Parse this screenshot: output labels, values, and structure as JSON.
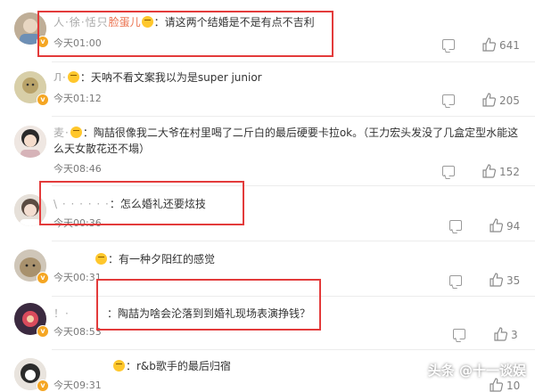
{
  "comments": [
    {
      "user": "人·徐·恬只",
      "user2": "脸蛋儿",
      "text": "：请这两个结婚是不是有点不吉利",
      "time": "今天01:00",
      "likes": "641"
    },
    {
      "user": "Л·",
      "text": "：天呐不看文案我以为是super junior",
      "time": "今天01:12",
      "likes": "205"
    },
    {
      "user": "麦·",
      "text": "：陶喆很像我二大爷在村里喝了二斤白的最后硬要卡拉ok。（王力宏头发没了几盒定型水能这么天女散花还不塌）",
      "time": "今天08:46",
      "likes": "152"
    },
    {
      "user": "\\ · · · · · ·",
      "text": "：怎么婚礼还要炫技",
      "time": "今天00:36",
      "likes": "94"
    },
    {
      "user": "",
      "text": "：有一种夕阳红的感觉",
      "time": "今天00:31",
      "likes": "35"
    },
    {
      "user": "！·",
      "text": "：陶喆为啥会沦落到到婚礼现场表演挣钱？",
      "time": "今天08:53",
      "likes": "3"
    },
    {
      "user": "",
      "text": "：r&b歌手的最后归宿",
      "time": "今天09:31",
      "likes": "10"
    }
  ],
  "watermark": "头条 @十一谈娱",
  "colors": {
    "username": "#eb7350",
    "highlight_box": "#e33b3b",
    "verified_badge": "#f5a623"
  }
}
